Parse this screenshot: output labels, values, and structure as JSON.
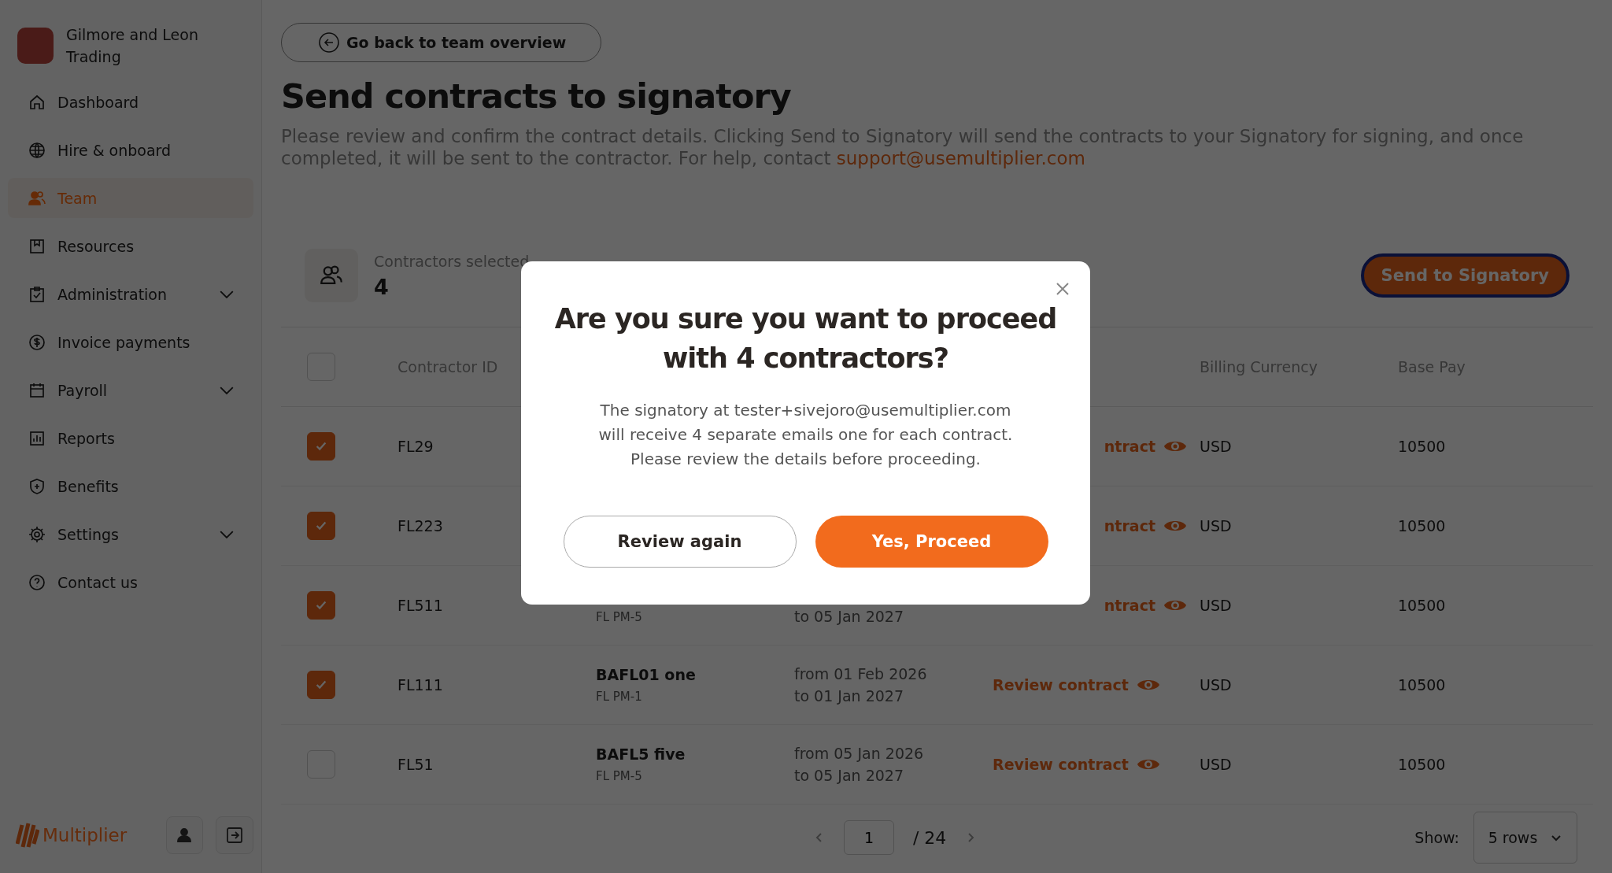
{
  "sidebar": {
    "company": "Gilmore and Leon Trading",
    "items": [
      {
        "label": "Dashboard",
        "kind": "home",
        "selected": false,
        "expandable": false
      },
      {
        "label": "Hire & onboard",
        "kind": "globe",
        "selected": false,
        "expandable": false
      },
      {
        "label": "Team",
        "kind": "people",
        "selected": true,
        "expandable": false
      },
      {
        "label": "Resources",
        "kind": "book",
        "selected": false,
        "expandable": false
      },
      {
        "label": "Administration",
        "kind": "clipboard",
        "selected": false,
        "expandable": true
      },
      {
        "label": "Invoice payments",
        "kind": "dollar",
        "selected": false,
        "expandable": false
      },
      {
        "label": "Payroll",
        "kind": "calendar",
        "selected": false,
        "expandable": true
      },
      {
        "label": "Reports",
        "kind": "chart",
        "selected": false,
        "expandable": false
      },
      {
        "label": "Benefits",
        "kind": "shield",
        "selected": false,
        "expandable": false
      },
      {
        "label": "Settings",
        "kind": "gear",
        "selected": false,
        "expandable": true
      },
      {
        "label": "Contact us",
        "kind": "help",
        "selected": false,
        "expandable": false
      }
    ],
    "brand": "Multiplier"
  },
  "back_button": "Go back to team overview",
  "title": "Send contracts to signatory",
  "intro": "Please review and confirm the contract details. Clicking Send to Signatory will send the contracts to your Signatory for signing, and once completed, it will be sent to the contractor. For help, contact ",
  "support_link": "support@usemultiplier.com",
  "summary": {
    "label": "Contractors selected",
    "count": "4",
    "button": "Send to Signatory"
  },
  "table": {
    "select_all_checked": false,
    "columns": [
      {
        "label": "Contractor ID"
      },
      {},
      {},
      {},
      {
        "label": "Billing Currency"
      },
      {
        "label": "Base Pay"
      }
    ],
    "rows": [
      {
        "checked": true,
        "id": "FL29",
        "link": "ntract",
        "currency": "USD",
        "pay": "10500"
      },
      {
        "checked": true,
        "id": "FL223",
        "link": "ntract",
        "currency": "USD",
        "pay": "10500"
      },
      {
        "checked": true,
        "id": "FL511",
        "sub": "FL PM-5",
        "to": "to 05 Jan 2027",
        "link": "ntract",
        "currency": "USD",
        "pay": "10500"
      },
      {
        "checked": true,
        "id": "FL111",
        "name": "BAFL01 one",
        "sub": "FL PM-1",
        "from": "from 01 Feb 2026",
        "to": "to 01 Jan 2027",
        "link": "Review contract",
        "currency": "USD",
        "pay": "10500"
      },
      {
        "checked": false,
        "id": "FL51",
        "name": "BAFL5 five",
        "sub": "FL PM-5",
        "from": "from 05 Jan 2026",
        "to": "to 05 Jan 2027",
        "link": "Review contract",
        "currency": "USD",
        "pay": "10500"
      }
    ]
  },
  "pagination": {
    "page": "1",
    "total": "/ 24",
    "show_label": "Show:",
    "rows_option": "5 rows"
  },
  "dialog": {
    "title": "Are you sure you want to proceed with 4 contractors?",
    "lines": [
      "The signatory at tester+sivejoro@usemultiplier.com",
      "will receive 4 separate emails one for each contract.",
      "Please review the details before proceeding."
    ],
    "secondary": "Review again",
    "primary": "Yes, Proceed"
  }
}
